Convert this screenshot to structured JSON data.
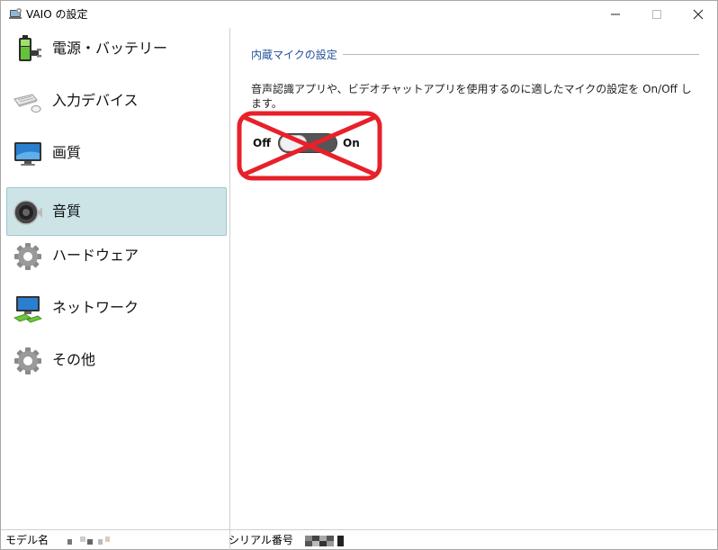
{
  "window": {
    "title": "VAIO の設定",
    "icons": {
      "app": "vaio-settings-icon",
      "minimize": "minimize-icon",
      "maximize": "maximize-icon",
      "close": "close-icon"
    }
  },
  "sidebar": {
    "selected": "音質",
    "items": [
      {
        "label": "電源・バッテリー",
        "icon": "battery-power-icon"
      },
      {
        "label": "入力デバイス",
        "icon": "keyboard-mouse-icon"
      },
      {
        "label": "画質",
        "icon": "monitor-icon"
      },
      {
        "label": "音質",
        "icon": "speaker-icon"
      },
      {
        "label": "ハードウェア",
        "icon": "gear-icon"
      },
      {
        "label": "ネットワーク",
        "icon": "network-icon"
      },
      {
        "label": "その他",
        "icon": "gear-icon"
      }
    ]
  },
  "main": {
    "section_title": "内蔵マイクの設定",
    "description": "音声認識アプリや、ビデオチャットアプリを使用するのに適したマイクの設定を On/Off します。",
    "toggle": {
      "off_label": "Off",
      "on_label": "On",
      "state": "Off"
    },
    "annotation": {
      "type": "red-x-mark",
      "color": "#e8202a"
    }
  },
  "status_bar": {
    "model_label": "モデル名",
    "serial_label": "シリアル番号"
  },
  "colors": {
    "selected_bg": "#cde4e7",
    "section_title": "#1f4f9a",
    "toggle_track": "#555555",
    "cross": "#e8202a"
  }
}
